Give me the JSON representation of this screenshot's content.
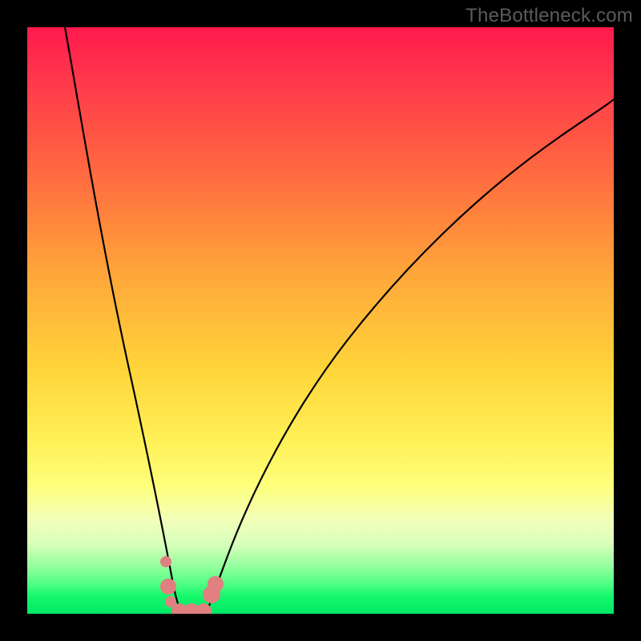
{
  "watermark": "TheBottleneck.com",
  "colors": {
    "background": "#000000",
    "gradient_top": "#ff1a4d",
    "gradient_bottom": "#00e865",
    "curve": "#000000",
    "marker": "#e08080"
  },
  "chart_data": {
    "type": "line",
    "title": "",
    "xlabel": "",
    "ylabel": "",
    "xlim": [
      0,
      100
    ],
    "ylim": [
      0,
      100
    ],
    "series": [
      {
        "name": "left-branch",
        "x": [
          6.4,
          8,
          10,
          12,
          14,
          16,
          18,
          20,
          22,
          23.5,
          25,
          26.3
        ],
        "y": [
          100,
          88,
          75,
          62,
          50,
          39,
          29,
          20,
          12,
          7,
          3,
          0
        ]
      },
      {
        "name": "right-branch",
        "x": [
          30.4,
          32,
          34,
          37,
          41,
          46,
          52,
          59,
          67,
          76,
          86,
          96,
          100
        ],
        "y": [
          0,
          3,
          8,
          15,
          24,
          34,
          44,
          54,
          63,
          72,
          79,
          86,
          88
        ]
      }
    ],
    "markers": [
      {
        "x": 23.6,
        "y": 8.9,
        "r": 1.0
      },
      {
        "x": 24.0,
        "y": 4.6,
        "r": 1.3
      },
      {
        "x": 24.4,
        "y": 2.0,
        "r": 1.0
      },
      {
        "x": 26.0,
        "y": 0.4,
        "r": 1.3
      },
      {
        "x": 28.0,
        "y": 0.4,
        "r": 1.3
      },
      {
        "x": 30.0,
        "y": 0.4,
        "r": 1.3
      },
      {
        "x": 31.4,
        "y": 3.3,
        "r": 1.5
      },
      {
        "x": 32.1,
        "y": 5.0,
        "r": 1.3
      }
    ]
  }
}
